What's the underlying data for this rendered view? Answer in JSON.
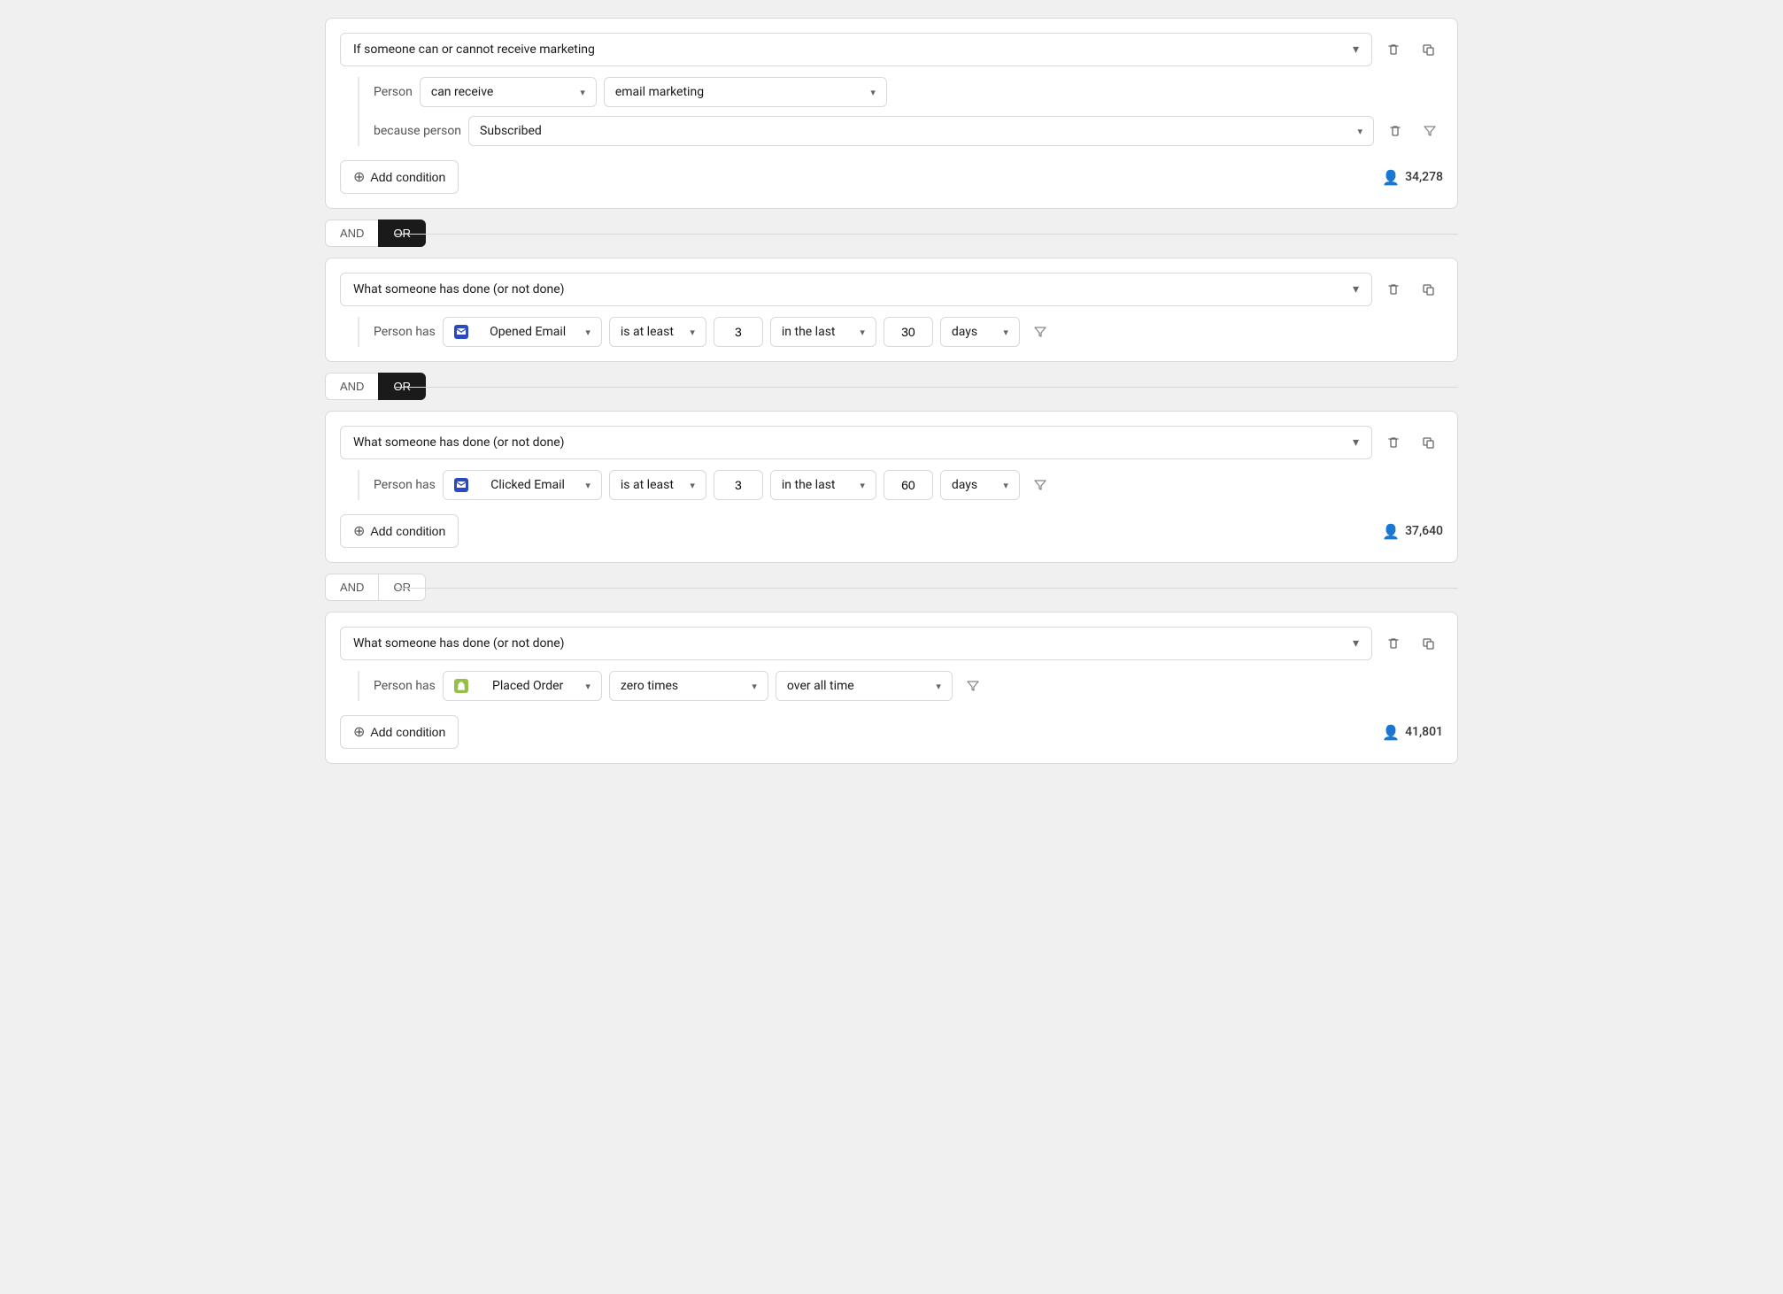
{
  "blocks": [
    {
      "id": "block-1",
      "main_label": "If someone can or cannot receive marketing",
      "type": "marketing",
      "sub_conditions": [
        {
          "label": "Person",
          "fields": [
            {
              "type": "select",
              "value": "can receive",
              "width": "can-receive"
            },
            {
              "type": "select",
              "value": "email marketing",
              "width": "email-marketing"
            }
          ]
        },
        {
          "label": "because person",
          "fields": [
            {
              "type": "select",
              "value": "Subscribed",
              "width": "subscribed"
            }
          ],
          "has_delete": true,
          "has_filter": true
        }
      ],
      "footer": {
        "add_label": "Add condition",
        "count": "34,278"
      }
    },
    {
      "id": "block-2",
      "main_label": "What someone has done (or not done)",
      "type": "action",
      "sub_conditions": [
        {
          "label": "Person has",
          "fields": [
            {
              "type": "select-event",
              "icon": "email",
              "value": "Opened Email"
            },
            {
              "type": "select",
              "value": "is at least",
              "class": "select-operator"
            },
            {
              "type": "number",
              "value": "3"
            },
            {
              "type": "select",
              "value": "in the last",
              "class": "select-time-range"
            },
            {
              "type": "number",
              "value": "30"
            },
            {
              "type": "select",
              "value": "days",
              "class": "select-time-unit"
            }
          ],
          "has_filter": true
        }
      ],
      "footer": null
    },
    {
      "id": "block-3",
      "main_label": "What someone has done (or not done)",
      "type": "action",
      "sub_conditions": [
        {
          "label": "Person has",
          "fields": [
            {
              "type": "select-event",
              "icon": "email",
              "value": "Clicked Email"
            },
            {
              "type": "select",
              "value": "is at least",
              "class": "select-operator"
            },
            {
              "type": "number",
              "value": "3"
            },
            {
              "type": "select",
              "value": "in the last",
              "class": "select-time-range"
            },
            {
              "type": "number",
              "value": "60"
            },
            {
              "type": "select",
              "value": "days",
              "class": "select-time-unit"
            }
          ],
          "has_filter": true
        }
      ],
      "footer": {
        "add_label": "Add condition",
        "count": "37,640"
      }
    },
    {
      "id": "block-4",
      "main_label": "What someone has done (or not done)",
      "type": "action",
      "sub_conditions": [
        {
          "label": "Person has",
          "fields": [
            {
              "type": "select-event",
              "icon": "shopify",
              "value": "Placed Order"
            },
            {
              "type": "select",
              "value": "zero times",
              "class": "select-operator-wide"
            },
            {
              "type": "select",
              "value": "over all time",
              "class": "select-time-wide"
            }
          ],
          "has_filter": true
        }
      ],
      "footer": {
        "add_label": "Add condition",
        "count": "41,801"
      }
    }
  ],
  "connectors": [
    {
      "between": "block-1",
      "and_active": false,
      "or_active": false,
      "and_label": "AND",
      "or_label": "OR"
    },
    {
      "between": "block-2",
      "and_active": false,
      "or_active": true,
      "and_label": "AND",
      "or_label": "OR"
    },
    {
      "between": "block-3",
      "and_active": false,
      "or_active": false,
      "and_label": "AND",
      "or_label": "OR"
    }
  ],
  "labels": {
    "add_condition": "Add condition",
    "person": "Person",
    "because_person": "because person",
    "person_has": "Person has"
  }
}
